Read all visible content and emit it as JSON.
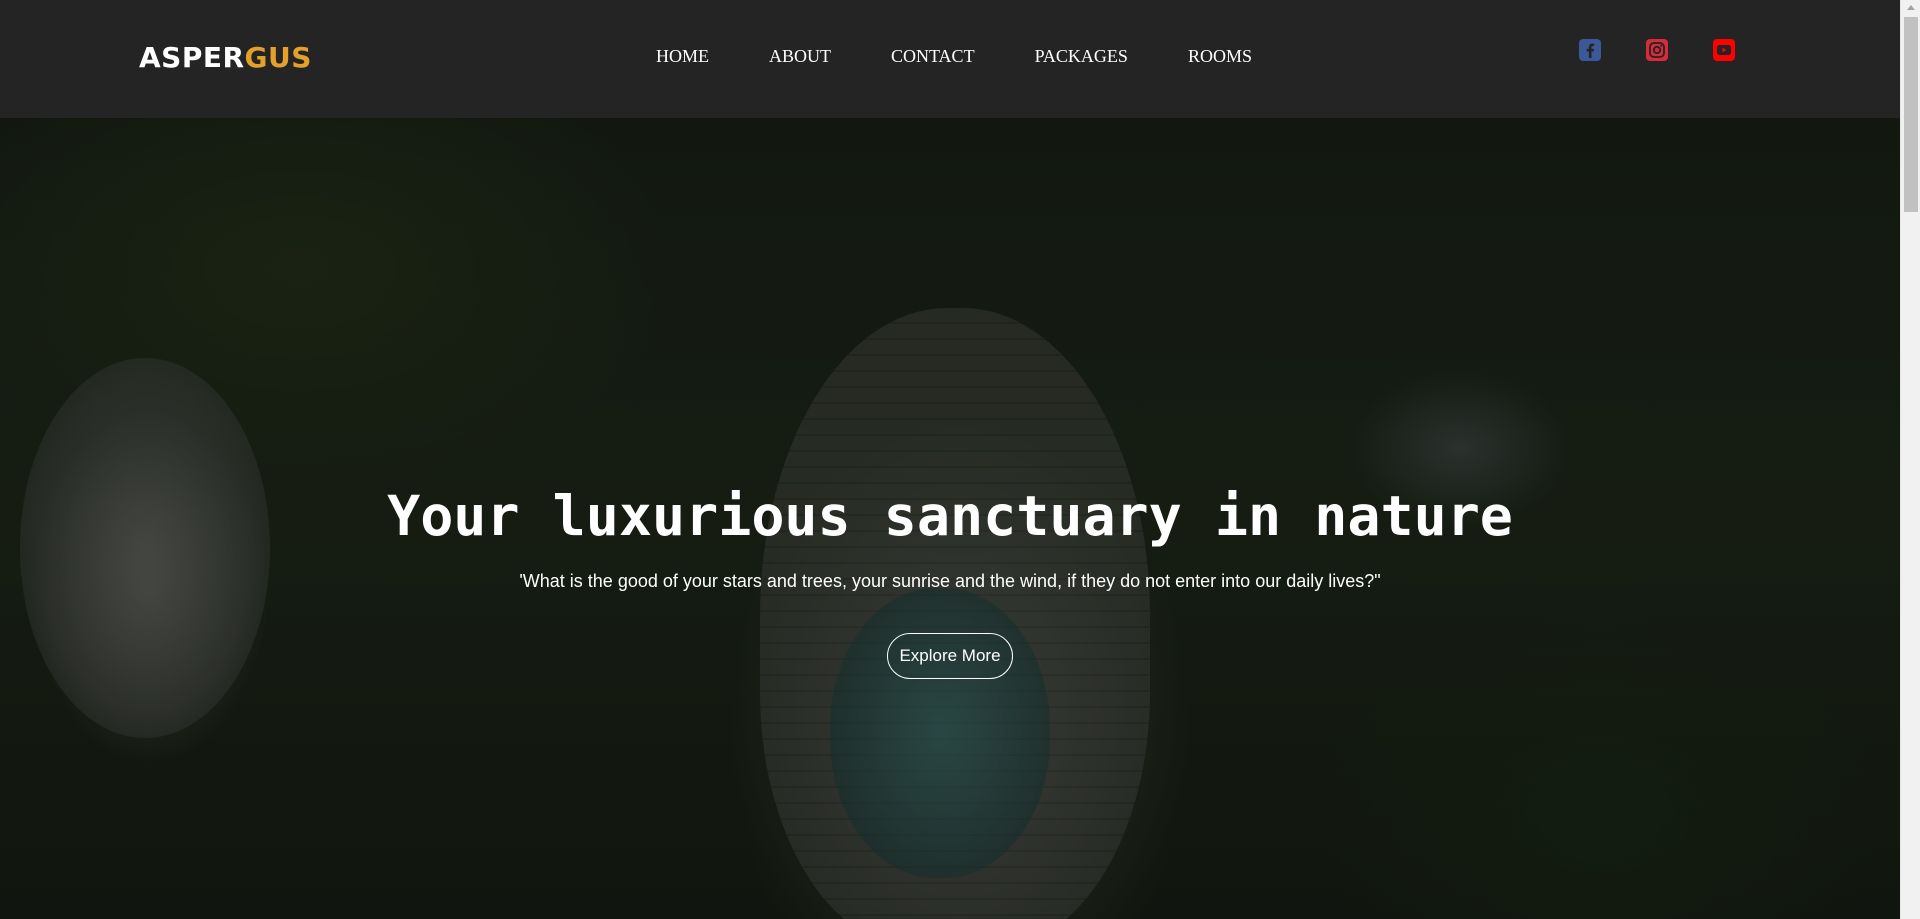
{
  "header": {
    "logo_part1": "ASPER",
    "logo_part2": "GUS",
    "logo_accent_color": "#e3a12c",
    "nav": [
      "HOME",
      "ABOUT",
      "CONTACT",
      "PACKAGES",
      "ROOMS"
    ],
    "social": [
      {
        "icon": "facebook-icon",
        "color": "#3b5998"
      },
      {
        "icon": "instagram-icon",
        "color": "#d62b3a"
      },
      {
        "icon": "youtube-icon",
        "color": "#ff0000"
      }
    ]
  },
  "hero": {
    "title": "Your luxurious sanctuary in nature",
    "quote": "'What is the good of your stars and trees, your sunrise and the wind, if they do not enter into our daily lives?\"",
    "cta_label": "Explore More"
  }
}
